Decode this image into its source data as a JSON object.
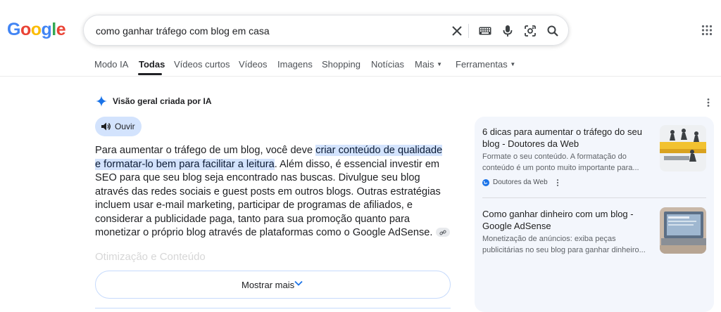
{
  "logo_letters": [
    {
      "ch": "G",
      "color": "#4285F4"
    },
    {
      "ch": "o",
      "color": "#EA4335"
    },
    {
      "ch": "o",
      "color": "#FBBC05"
    },
    {
      "ch": "g",
      "color": "#4285F4"
    },
    {
      "ch": "l",
      "color": "#34A853"
    },
    {
      "ch": "e",
      "color": "#EA4335"
    }
  ],
  "search": {
    "query": "como ganhar tráfego com blog em casa",
    "icons": [
      "close-icon",
      "keyboard-icon",
      "microphone-icon",
      "lens-icon",
      "search-icon"
    ]
  },
  "tabs": [
    {
      "label": "Modo IA",
      "active": false
    },
    {
      "label": "Todas",
      "active": true
    },
    {
      "label": "Vídeos curtos",
      "active": false
    },
    {
      "label": "Vídeos",
      "active": false
    },
    {
      "label": "Imagens",
      "active": false
    },
    {
      "label": "Shopping",
      "active": false
    },
    {
      "label": "Notícias",
      "active": false
    },
    {
      "label": "Mais",
      "active": false,
      "dropdown": true
    },
    {
      "label": "Ferramentas",
      "active": false,
      "dropdown": true
    }
  ],
  "ai_overview": {
    "heading": "Visão geral criada por IA",
    "listen_label": "Ouvir",
    "text_before": "Para aumentar o tráfego de um blog, você deve ",
    "highlight": "criar conteúdo de qualidade e formatar-lo bem para facilitar a leitura",
    "text_after": ". Além disso, é essencial investir em SEO para que seu blog seja encontrado nas buscas. Divulgue seu blog através das redes sociais e guest posts em outros blogs. Outras estratégias incluem usar e-mail marketing, participar de programas de afiliados, e considerar a publicidade paga, tanto para sua promoção quanto para monetizar o próprio blog através de plataformas como o Google AdSense.",
    "faded_heading": "Otimização e Conteúdo",
    "show_more_label": "Mostrar mais"
  },
  "sources": [
    {
      "title": "6 dicas para aumentar o tráfego do seu blog - Doutores da Web",
      "snippet": "Formate o seu conteúdo. A formatação do conteúdo é um ponto muito importante para...",
      "site": "Doutores da Web"
    },
    {
      "title": "Como ganhar dinheiro com um blog - Google AdSense",
      "snippet": "Monetização de anúncios: exiba peças publicitárias no seu blog para ganhar dinheiro..."
    }
  ],
  "colors": {
    "accent_blue": "#1a73e8",
    "highlight": "#d3e3fd",
    "panel_bg": "#f3f6fc"
  }
}
